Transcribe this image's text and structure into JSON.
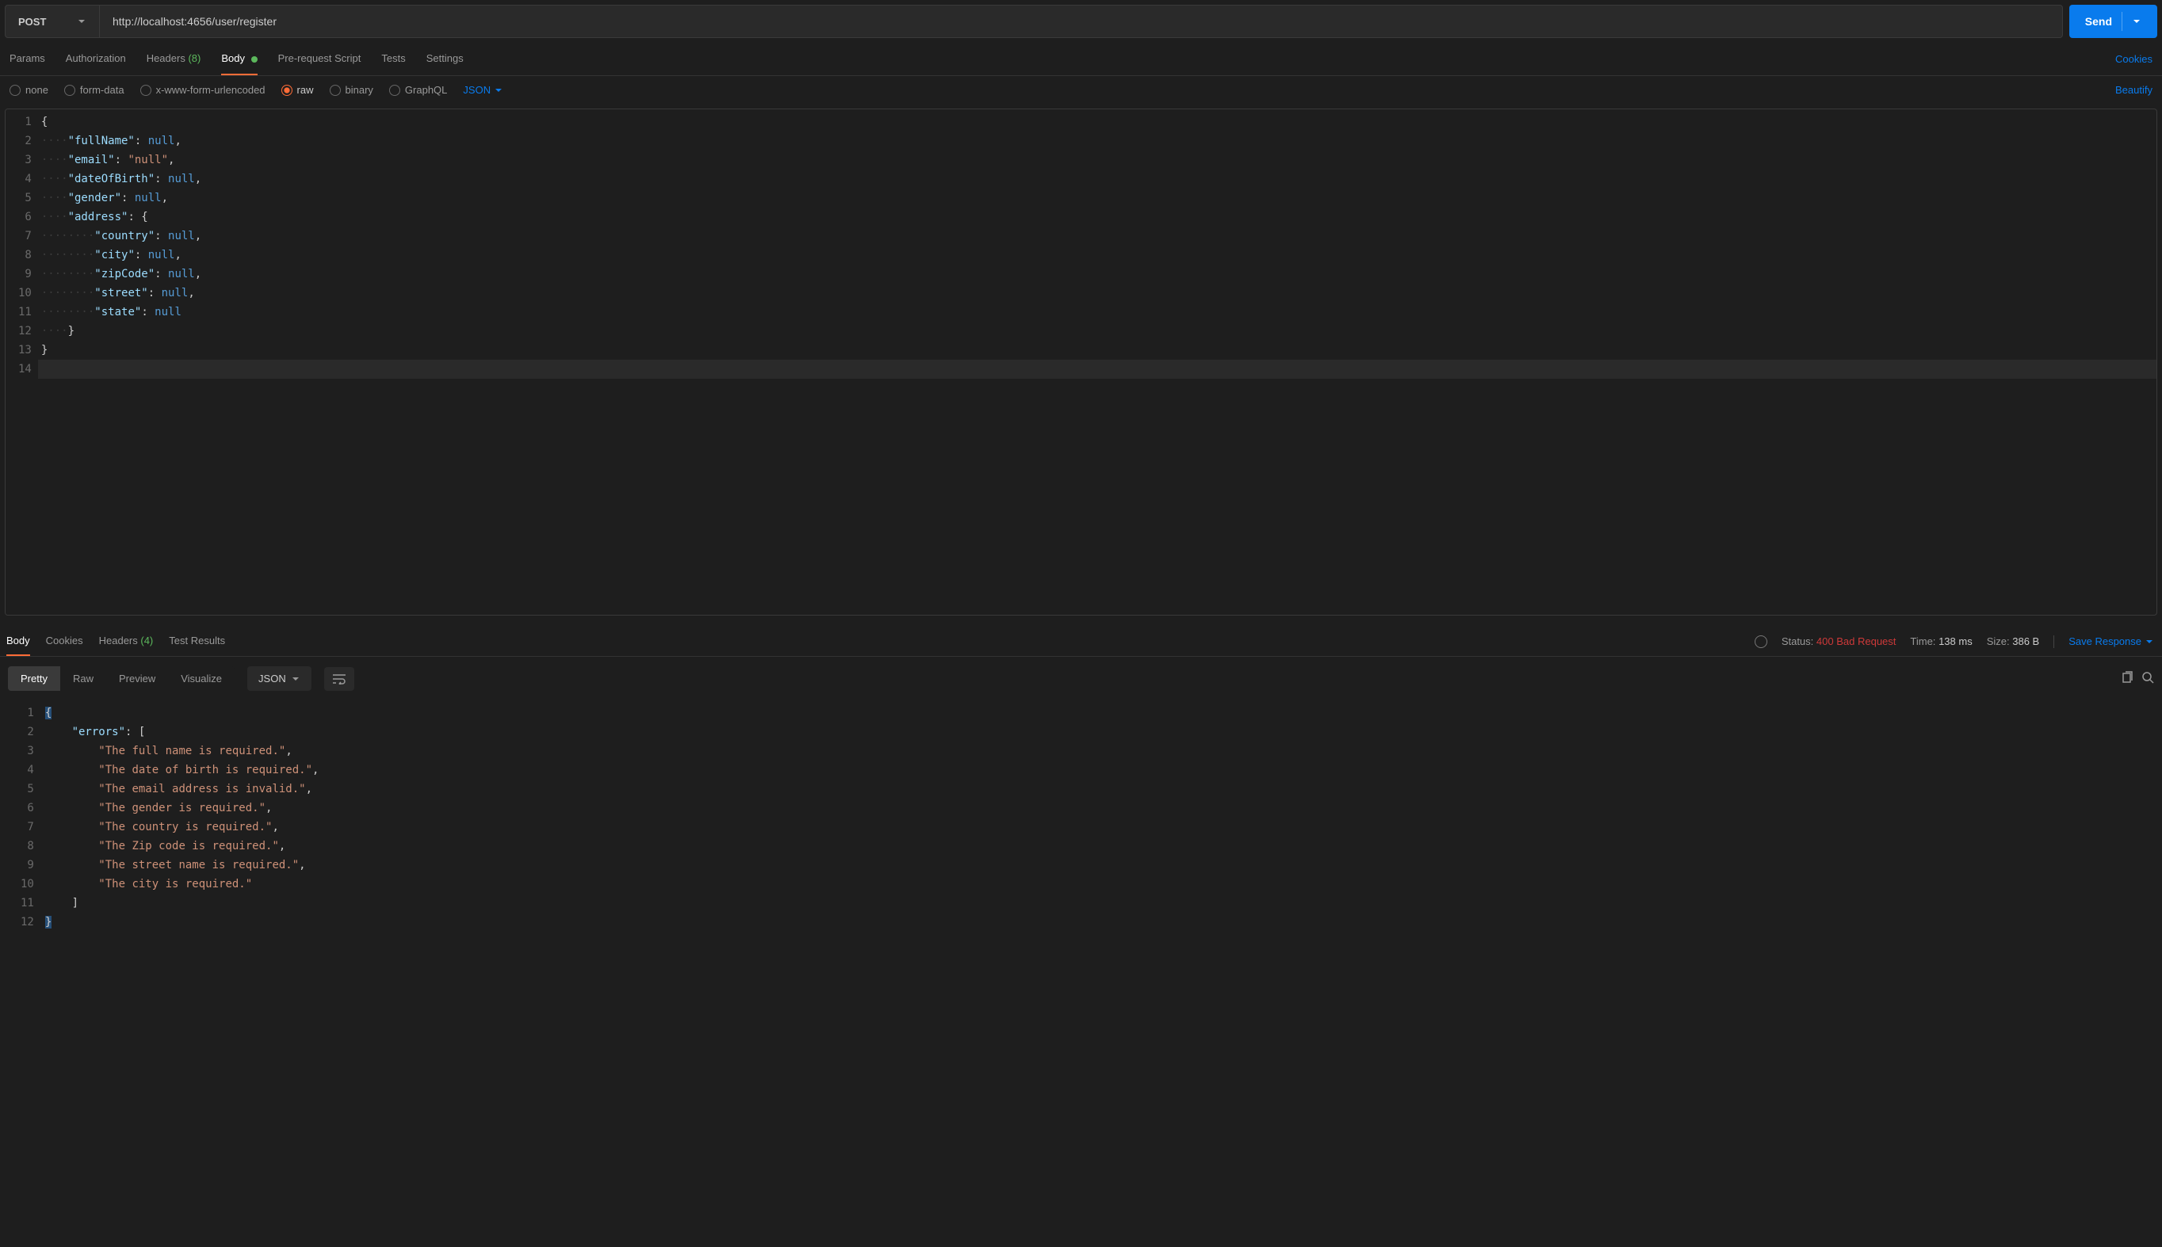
{
  "request": {
    "method": "POST",
    "url": "http://localhost:4656/user/register",
    "sendLabel": "Send"
  },
  "requestTabs": {
    "params": "Params",
    "authorization": "Authorization",
    "headersLabel": "Headers",
    "headersCount": "(8)",
    "body": "Body",
    "preRequest": "Pre-request Script",
    "tests": "Tests",
    "settings": "Settings",
    "cookiesLink": "Cookies"
  },
  "bodyTypes": {
    "none": "none",
    "formData": "form-data",
    "urlencoded": "x-www-form-urlencoded",
    "raw": "raw",
    "binary": "binary",
    "graphql": "GraphQL",
    "format": "JSON",
    "beautify": "Beautify"
  },
  "requestBody": {
    "lines": [
      {
        "n": "1",
        "pre": "",
        "t": [
          {
            "c": "brace",
            "v": "{"
          }
        ]
      },
      {
        "n": "2",
        "pre": "····",
        "t": [
          {
            "c": "key",
            "v": "\"fullName\""
          },
          {
            "c": "punct",
            "v": ": "
          },
          {
            "c": "null",
            "v": "null"
          },
          {
            "c": "punct",
            "v": ","
          }
        ]
      },
      {
        "n": "3",
        "pre": "····",
        "t": [
          {
            "c": "key",
            "v": "\"email\""
          },
          {
            "c": "punct",
            "v": ": "
          },
          {
            "c": "str",
            "v": "\"null\""
          },
          {
            "c": "punct",
            "v": ","
          }
        ]
      },
      {
        "n": "4",
        "pre": "····",
        "t": [
          {
            "c": "key",
            "v": "\"dateOfBirth\""
          },
          {
            "c": "punct",
            "v": ": "
          },
          {
            "c": "null",
            "v": "null"
          },
          {
            "c": "punct",
            "v": ","
          }
        ]
      },
      {
        "n": "5",
        "pre": "····",
        "t": [
          {
            "c": "key",
            "v": "\"gender\""
          },
          {
            "c": "punct",
            "v": ": "
          },
          {
            "c": "null",
            "v": "null"
          },
          {
            "c": "punct",
            "v": ","
          }
        ]
      },
      {
        "n": "6",
        "pre": "····",
        "t": [
          {
            "c": "key",
            "v": "\"address\""
          },
          {
            "c": "punct",
            "v": ": "
          },
          {
            "c": "brace",
            "v": "{"
          }
        ]
      },
      {
        "n": "7",
        "pre": "········",
        "t": [
          {
            "c": "key",
            "v": "\"country\""
          },
          {
            "c": "punct",
            "v": ": "
          },
          {
            "c": "null",
            "v": "null"
          },
          {
            "c": "punct",
            "v": ","
          }
        ]
      },
      {
        "n": "8",
        "pre": "········",
        "t": [
          {
            "c": "key",
            "v": "\"city\""
          },
          {
            "c": "punct",
            "v": ": "
          },
          {
            "c": "null",
            "v": "null"
          },
          {
            "c": "punct",
            "v": ","
          }
        ]
      },
      {
        "n": "9",
        "pre": "········",
        "t": [
          {
            "c": "key",
            "v": "\"zipCode\""
          },
          {
            "c": "punct",
            "v": ": "
          },
          {
            "c": "null",
            "v": "null"
          },
          {
            "c": "punct",
            "v": ","
          }
        ]
      },
      {
        "n": "10",
        "pre": "········",
        "t": [
          {
            "c": "key",
            "v": "\"street\""
          },
          {
            "c": "punct",
            "v": ": "
          },
          {
            "c": "null",
            "v": "null"
          },
          {
            "c": "punct",
            "v": ","
          }
        ]
      },
      {
        "n": "11",
        "pre": "········",
        "t": [
          {
            "c": "key",
            "v": "\"state\""
          },
          {
            "c": "punct",
            "v": ": "
          },
          {
            "c": "null",
            "v": "null"
          }
        ]
      },
      {
        "n": "12",
        "pre": "····",
        "t": [
          {
            "c": "brace",
            "v": "}"
          }
        ]
      },
      {
        "n": "13",
        "pre": "",
        "t": [
          {
            "c": "brace",
            "v": "}"
          }
        ]
      },
      {
        "n": "14",
        "pre": "",
        "t": [],
        "cursor": true
      }
    ]
  },
  "responseTabs": {
    "body": "Body",
    "cookies": "Cookies",
    "headersLabel": "Headers",
    "headersCount": "(4)",
    "testResults": "Test Results"
  },
  "responseMeta": {
    "statusLabel": "Status:",
    "statusCode": "400",
    "statusText": "Bad Request",
    "timeLabel": "Time:",
    "timeValue": "138 ms",
    "sizeLabel": "Size:",
    "sizeValue": "386 B",
    "saveLabel": "Save Response"
  },
  "viewModes": {
    "pretty": "Pretty",
    "raw": "Raw",
    "preview": "Preview",
    "visualize": "Visualize",
    "format": "JSON"
  },
  "responseBody": {
    "lines": [
      {
        "n": "1",
        "pre": "",
        "t": [
          {
            "c": "brace",
            "v": "{"
          }
        ],
        "sel": true
      },
      {
        "n": "2",
        "pre": "    ",
        "t": [
          {
            "c": "key",
            "v": "\"errors\""
          },
          {
            "c": "punct",
            "v": ": "
          },
          {
            "c": "brace",
            "v": "["
          }
        ]
      },
      {
        "n": "3",
        "pre": "        ",
        "t": [
          {
            "c": "str",
            "v": "\"The full name is required.\""
          },
          {
            "c": "punct",
            "v": ","
          }
        ]
      },
      {
        "n": "4",
        "pre": "        ",
        "t": [
          {
            "c": "str",
            "v": "\"The date of birth is required.\""
          },
          {
            "c": "punct",
            "v": ","
          }
        ]
      },
      {
        "n": "5",
        "pre": "        ",
        "t": [
          {
            "c": "str",
            "v": "\"The email address is invalid.\""
          },
          {
            "c": "punct",
            "v": ","
          }
        ]
      },
      {
        "n": "6",
        "pre": "        ",
        "t": [
          {
            "c": "str",
            "v": "\"The gender is required.\""
          },
          {
            "c": "punct",
            "v": ","
          }
        ]
      },
      {
        "n": "7",
        "pre": "        ",
        "t": [
          {
            "c": "str",
            "v": "\"The country is required.\""
          },
          {
            "c": "punct",
            "v": ","
          }
        ]
      },
      {
        "n": "8",
        "pre": "        ",
        "t": [
          {
            "c": "str",
            "v": "\"The Zip code is required.\""
          },
          {
            "c": "punct",
            "v": ","
          }
        ]
      },
      {
        "n": "9",
        "pre": "        ",
        "t": [
          {
            "c": "str",
            "v": "\"The street name is required.\""
          },
          {
            "c": "punct",
            "v": ","
          }
        ]
      },
      {
        "n": "10",
        "pre": "        ",
        "t": [
          {
            "c": "str",
            "v": "\"The city is required.\""
          }
        ]
      },
      {
        "n": "11",
        "pre": "    ",
        "t": [
          {
            "c": "brace",
            "v": "]"
          }
        ]
      },
      {
        "n": "12",
        "pre": "",
        "t": [
          {
            "c": "brace",
            "v": "}"
          }
        ],
        "sel": true
      }
    ]
  }
}
